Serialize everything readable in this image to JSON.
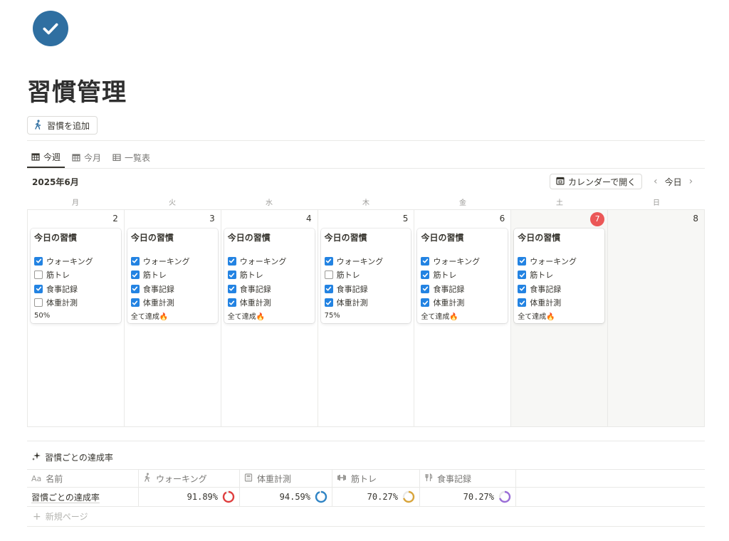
{
  "page": {
    "title": "習慣管理",
    "add_habit_label": "習慣を追加"
  },
  "tabs": [
    {
      "label": "今週",
      "active": true,
      "icon": "calendar-icon"
    },
    {
      "label": "今月",
      "active": false,
      "icon": "calendar-icon"
    },
    {
      "label": "一覧表",
      "active": false,
      "icon": "table-icon"
    }
  ],
  "calendar": {
    "month_label": "2025年6月",
    "open_button_label": "カレンダーで開く",
    "today_label": "今日",
    "weekdays": [
      "月",
      "火",
      "水",
      "木",
      "金",
      "土",
      "日"
    ],
    "days": [
      {
        "num": "2",
        "today": false,
        "weekend": false,
        "card": {
          "title": "今日の習慣",
          "habits": [
            {
              "name": "ウォーキング",
              "done": true
            },
            {
              "name": "筋トレ",
              "done": false
            },
            {
              "name": "食事記録",
              "done": true
            },
            {
              "name": "体重計測",
              "done": false
            }
          ],
          "status": "50%"
        }
      },
      {
        "num": "3",
        "today": false,
        "weekend": false,
        "card": {
          "title": "今日の習慣",
          "habits": [
            {
              "name": "ウォーキング",
              "done": true
            },
            {
              "name": "筋トレ",
              "done": true
            },
            {
              "name": "食事記録",
              "done": true
            },
            {
              "name": "体重計測",
              "done": true
            }
          ],
          "status": "全て達成🔥"
        }
      },
      {
        "num": "4",
        "today": false,
        "weekend": false,
        "card": {
          "title": "今日の習慣",
          "habits": [
            {
              "name": "ウォーキング",
              "done": true
            },
            {
              "name": "筋トレ",
              "done": true
            },
            {
              "name": "食事記録",
              "done": true
            },
            {
              "name": "体重計測",
              "done": true
            }
          ],
          "status": "全て達成🔥"
        }
      },
      {
        "num": "5",
        "today": false,
        "weekend": false,
        "card": {
          "title": "今日の習慣",
          "habits": [
            {
              "name": "ウォーキング",
              "done": true
            },
            {
              "name": "筋トレ",
              "done": false
            },
            {
              "name": "食事記録",
              "done": true
            },
            {
              "name": "体重計測",
              "done": true
            }
          ],
          "status": "75%"
        }
      },
      {
        "num": "6",
        "today": false,
        "weekend": false,
        "card": {
          "title": "今日の習慣",
          "habits": [
            {
              "name": "ウォーキング",
              "done": true
            },
            {
              "name": "筋トレ",
              "done": true
            },
            {
              "name": "食事記録",
              "done": true
            },
            {
              "name": "体重計測",
              "done": true
            }
          ],
          "status": "全て達成🔥"
        }
      },
      {
        "num": "7",
        "today": true,
        "weekend": true,
        "card": {
          "title": "今日の習慣",
          "habits": [
            {
              "name": "ウォーキング",
              "done": true
            },
            {
              "name": "筋トレ",
              "done": true
            },
            {
              "name": "食事記録",
              "done": true
            },
            {
              "name": "体重計測",
              "done": true
            }
          ],
          "status": "全て達成🔥"
        }
      },
      {
        "num": "8",
        "today": false,
        "weekend": true,
        "card": null
      }
    ]
  },
  "stats": {
    "section_title": "習慣ごとの達成率",
    "columns": [
      {
        "label": "名前",
        "icon": "text-property-icon"
      },
      {
        "label": "ウォーキング",
        "icon": "walking-icon"
      },
      {
        "label": "体重計測",
        "icon": "scale-icon"
      },
      {
        "label": "筋トレ",
        "icon": "dumbbell-icon"
      },
      {
        "label": "食事記録",
        "icon": "fork-knife-icon"
      }
    ],
    "row": {
      "name": "習慣ごとの達成率",
      "values": [
        {
          "text": "91.89%",
          "fraction": 0.9189,
          "color": "#e03e3e"
        },
        {
          "text": "94.59%",
          "fraction": 0.9459,
          "color": "#2f84c5"
        },
        {
          "text": "70.27%",
          "fraction": 0.7027,
          "color": "#d9a53b"
        },
        {
          "text": "70.27%",
          "fraction": 0.7027,
          "color": "#9a6dd7"
        }
      ]
    },
    "new_page_label": "新規ページ"
  },
  "colors": {
    "accent": "#2383e2",
    "page_icon_bg": "#2f6fa1",
    "today_badge": "#eb5757"
  }
}
